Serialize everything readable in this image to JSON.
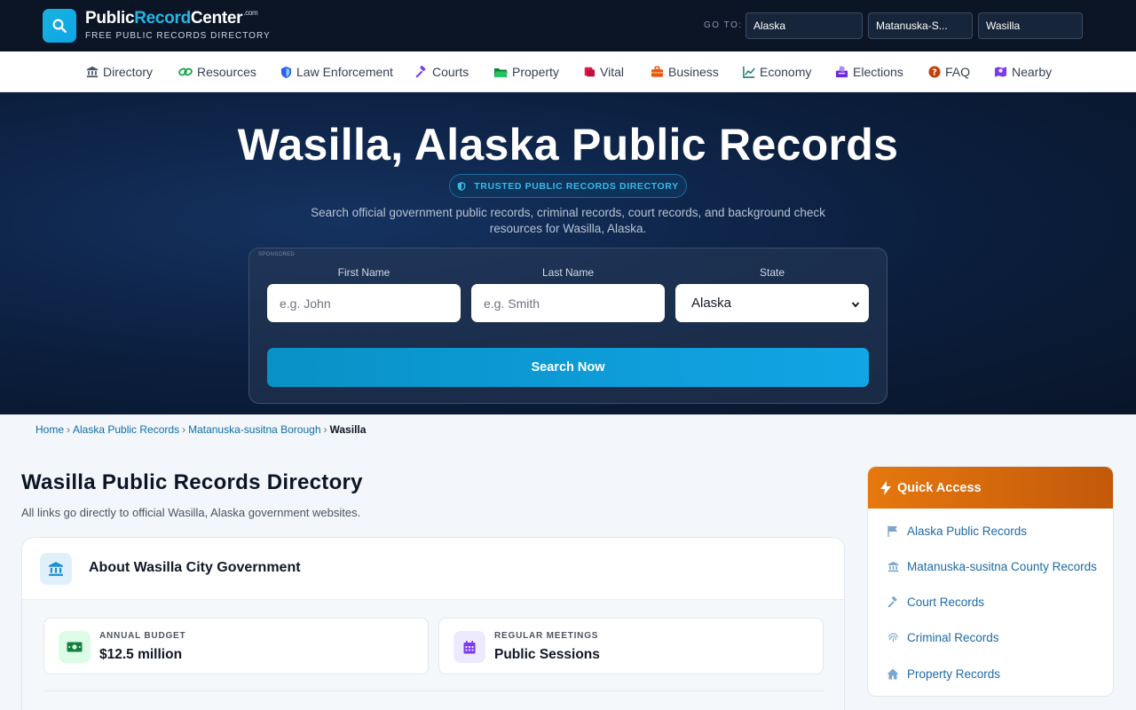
{
  "header": {
    "brand_public": "Public",
    "brand_record": "Record",
    "brand_center": "Center",
    "brand_dotcom": ".com",
    "tagline": "FREE PUBLIC RECORDS DIRECTORY",
    "goto_label": "GO TO:",
    "goto_state": "Alaska",
    "goto_county": "Matanuska-S...",
    "goto_city": "Wasilla"
  },
  "nav": {
    "items": [
      {
        "label": "Directory",
        "icon": "bank-icon"
      },
      {
        "label": "Resources",
        "icon": "link-icon"
      },
      {
        "label": "Law Enforcement",
        "icon": "shield-icon"
      },
      {
        "label": "Courts",
        "icon": "gavel-icon"
      },
      {
        "label": "Property",
        "icon": "folder-icon"
      },
      {
        "label": "Vital",
        "icon": "scroll-icon"
      },
      {
        "label": "Business",
        "icon": "briefcase-icon"
      },
      {
        "label": "Economy",
        "icon": "chart-line-icon"
      },
      {
        "label": "Elections",
        "icon": "vote-icon"
      },
      {
        "label": "FAQ",
        "icon": "question-icon"
      },
      {
        "label": "Nearby",
        "icon": "map-pin-icon"
      }
    ]
  },
  "hero": {
    "title": "Wasilla, Alaska Public Records",
    "badge": "TRUSTED PUBLIC RECORDS DIRECTORY",
    "subtitle": "Search official government public records, criminal records, court records, and background check resources for Wasilla, Alaska."
  },
  "search": {
    "sponsored": "SPONSORED",
    "first_name_label": "First Name",
    "first_name_placeholder": "e.g. John",
    "last_name_label": "Last Name",
    "last_name_placeholder": "e.g. Smith",
    "state_label": "State",
    "state_value": "Alaska",
    "button_label": "Search Now"
  },
  "breadcrumb": {
    "home": "Home",
    "state": "Alaska Public Records",
    "county": "Matanuska-susitna Borough",
    "current": "Wasilla",
    "separator": "›"
  },
  "main": {
    "title": "Wasilla Public Records Directory",
    "subtitle": "All links go directly to official Wasilla, Alaska government websites.",
    "about": {
      "title": "About Wasilla City Government",
      "stats": [
        {
          "label": "ANNUAL BUDGET",
          "value": "$12.5 million",
          "icon": "money-icon"
        },
        {
          "label": "REGULAR MEETINGS",
          "value": "Public Sessions",
          "icon": "calendar-icon"
        }
      ]
    }
  },
  "quick_access": {
    "title": "Quick Access",
    "items": [
      {
        "label": "Alaska Public Records",
        "icon": "flag-icon"
      },
      {
        "label": "Matanuska-susitna County Records",
        "icon": "bank-icon"
      },
      {
        "label": "Court Records",
        "icon": "gavel-icon"
      },
      {
        "label": "Criminal Records",
        "icon": "fingerprint-icon"
      },
      {
        "label": "Property Records",
        "icon": "home-icon"
      }
    ]
  },
  "colors": {
    "header_bg": "#0b1526",
    "accent": "#22b8e8",
    "search_button": "#11a5e5",
    "quick_access_header": "#e6780e",
    "link": "#1e6aa6"
  }
}
